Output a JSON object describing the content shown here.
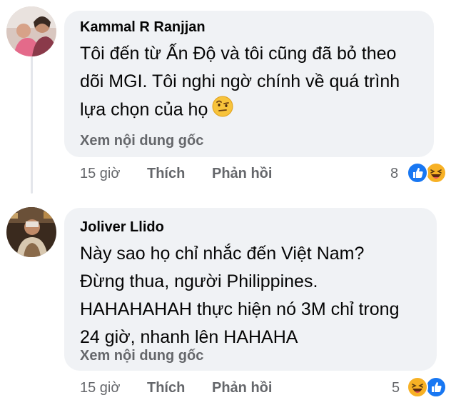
{
  "comments": [
    {
      "author": "Kammal R Ranjjan",
      "lines": [
        "Tôi đến từ Ấn Độ và tôi cũng đã bỏ theo",
        "dõi MGI. Tôi nghi ngờ chính về quá trình",
        "lựa chọn của họ"
      ],
      "inline_emoji": "face-with-raised-eyebrow",
      "see_original": "Xem nội dung gốc",
      "time": "15 giờ",
      "like": "Thích",
      "reply": "Phản hồi",
      "reaction_count": "8",
      "reactions": [
        "like-icon",
        "haha-icon"
      ]
    },
    {
      "author": "Joliver Llido",
      "lines": [
        "Này sao họ chỉ nhắc đến Việt Nam?",
        "Đừng thua, người Philippines.",
        "HAHAHAHAH thực hiện nó 3M chỉ trong",
        "24 giờ, nhanh lên HAHAHA"
      ],
      "see_original": "Xem nội dung gốc",
      "time": "15 giờ",
      "like": "Thích",
      "reply": "Phản hồi",
      "reaction_count": "5",
      "reactions": [
        "haha-icon",
        "like-icon"
      ]
    }
  ],
  "colors": {
    "bubble": "#f0f2f5",
    "secondary_text": "#65676b",
    "like_blue": "#1877f2",
    "haha_yellow": "#f7b125"
  }
}
